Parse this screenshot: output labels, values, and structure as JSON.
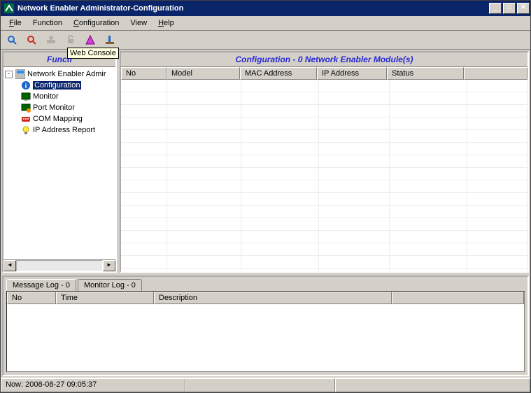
{
  "window": {
    "title": "Network Enabler Administrator-Configuration"
  },
  "menu": {
    "file": "File",
    "function": "Function",
    "configuration": "Configuration",
    "view": "View",
    "help": "Help"
  },
  "toolbar": {
    "tooltip": "Web Console"
  },
  "left_panel": {
    "header": "Functi"
  },
  "tree": {
    "root": "Network Enabler Admir",
    "items": [
      "Configuration",
      "Monitor",
      "Port Monitor",
      "COM Mapping",
      "IP Address Report"
    ]
  },
  "right_panel": {
    "header": "Configuration - 0 Network Enabler Module(s)",
    "columns": [
      "No",
      "Model",
      "MAC Address",
      "IP Address",
      "Status"
    ]
  },
  "tabs": {
    "message": "Message Log - 0",
    "monitor": "Monitor Log - 0"
  },
  "log_columns": [
    "No",
    "Time",
    "Description"
  ],
  "statusbar": {
    "now": "Now: 2008-08-27 09:05:37"
  },
  "colors": {
    "title_bg": "#0a246a",
    "header_text": "#2828d8"
  }
}
